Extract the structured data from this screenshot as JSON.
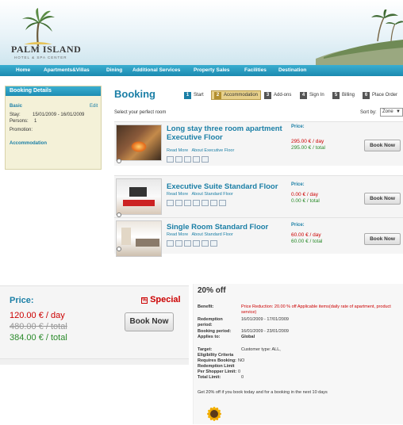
{
  "brand": {
    "title": "PALM ISLAND",
    "subtitle": "HOTEL & SPA CENTER"
  },
  "nav": [
    "Home",
    "Apartments&Villas",
    "Dining",
    "Additional Services",
    "Property Sales",
    "Facilities",
    "Destination"
  ],
  "sidebar": {
    "heading": "Booking Details",
    "section": "Basic",
    "edit": "Edit",
    "stay_label": "Stay:",
    "stay_value": "15/01/2009 - 16/01/2009",
    "persons_label": "Persons:",
    "persons_value": "1",
    "promotion_label": "Promotion:",
    "accommodation": "Accommodation"
  },
  "main": {
    "title": "Booking",
    "steps": [
      {
        "num": "1",
        "label": "Start"
      },
      {
        "num": "2",
        "label": "Accommodation"
      },
      {
        "num": "3",
        "label": "Add-ons"
      },
      {
        "num": "4",
        "label": "Sign In"
      },
      {
        "num": "5",
        "label": "Billing"
      },
      {
        "num": "6",
        "label": "Place Order"
      }
    ],
    "subline": "Select your perfect room",
    "sort_label": "Sort by:",
    "sort_value": "Zone"
  },
  "rooms": [
    {
      "name": "Long stay three room apartment Executive Floor",
      "read_more": "Read More",
      "about": "About Executive Floor",
      "price_label": "Price:",
      "day": "295.00 € / day",
      "total": "295.00 € / total",
      "book": "Book Now"
    },
    {
      "name": "Executive Suite Standard Floor",
      "read_more": "Read More",
      "about": "About Standard Floor",
      "price_label": "Price:",
      "day": "0.00 € / day",
      "total": "0.00 € / total",
      "book": "Book Now"
    },
    {
      "name": "Single Room Standard Floor",
      "read_more": "Read More",
      "about": "About Standard Floor",
      "price_label": "Price:",
      "day": "60.00 € / day",
      "total": "60.00 € / total",
      "book": "Book Now"
    }
  ],
  "zoom_price": {
    "label": "Price:",
    "special": "Special",
    "day": "120.00 € / day",
    "old": "480.00 € / total",
    "total": "384.00 € / total",
    "book": "Book Now"
  },
  "promo": {
    "title": "20% off",
    "benefit_label": "Benefit:",
    "benefit_value": "Price Reduction: 20.00 % off Applicable items(daily rate of apartment, product service)",
    "redemption_label": "Redemption period:",
    "redemption_value": "16/01/2009 - 17/01/2009",
    "booking_label": "Booking period:",
    "booking_value": "16/01/2009 - 23/01/2009",
    "applies_label": "Applies to:",
    "applies_value": "Global",
    "target_label": "Target:",
    "target_value": "Customer type: ALL,",
    "eligibility_label": "Eligibility Criteria",
    "requires_label": "Requires Booking:",
    "requires_value": "NO",
    "limit_label": "Redemption Limit",
    "per_shopper_label": "Per Shopper Limit:",
    "per_shopper_value": "0",
    "total_limit_label": "Total Limit:",
    "total_limit_value": "0",
    "note": "Get 20% off if you book today and for a booking in the next 10 days"
  },
  "colors": {
    "accent": "#1b7fa6",
    "price_day": "#cc0000",
    "price_total": "#2a8a2a",
    "sidebar_bg": "#f4f1d8"
  }
}
